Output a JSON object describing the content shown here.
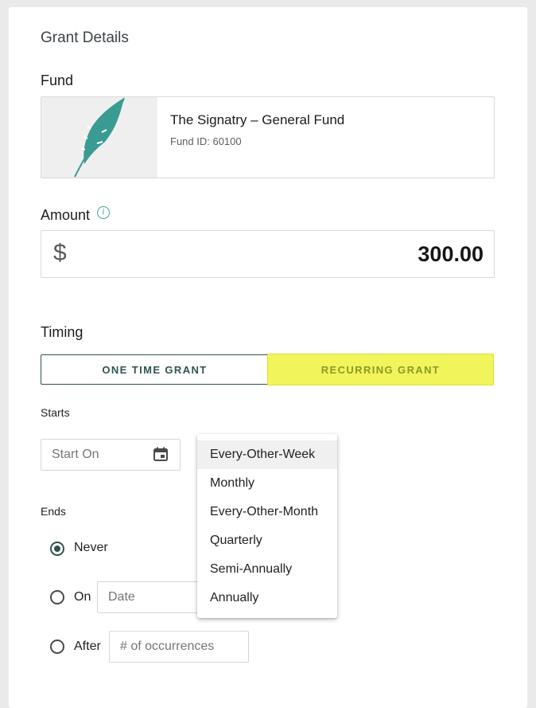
{
  "grant": {
    "section_title": "Grant Details",
    "fund_label": "Fund",
    "fund": {
      "name": "The Signatry – General Fund",
      "id_text": "Fund ID: 60100",
      "logo_icon": "feather-icon",
      "logo_color": "#3a9b92"
    },
    "amount_label": "Amount",
    "info_icon": "info-icon",
    "currency_symbol": "$",
    "amount_value": "300.00",
    "timing_label": "Timing",
    "toggle": {
      "one_time": "ONE TIME GRANT",
      "recurring": "RECURRING GRANT",
      "selected": "recurring",
      "selected_color": "#f1f45a"
    },
    "starts_label": "Starts",
    "start_placeholder": "Start On",
    "calendar_icon": "calendar-icon",
    "ends_label": "Ends",
    "ends_options": {
      "never": "Never",
      "on": "On",
      "after": "After",
      "selected": "never"
    },
    "date_placeholder": "Date",
    "occurrences_placeholder": "# of occurrences",
    "frequency_dropdown": {
      "options": [
        "Every-Other-Week",
        "Monthly",
        "Every-Other-Month",
        "Quarterly",
        "Semi-Annually",
        "Annually"
      ],
      "highlighted": "Every-Other-Week"
    }
  },
  "colors": {
    "accent_dark": "#2f5450",
    "accent_teal": "#3aa39a",
    "recurring_yellow": "#f1f45a"
  }
}
